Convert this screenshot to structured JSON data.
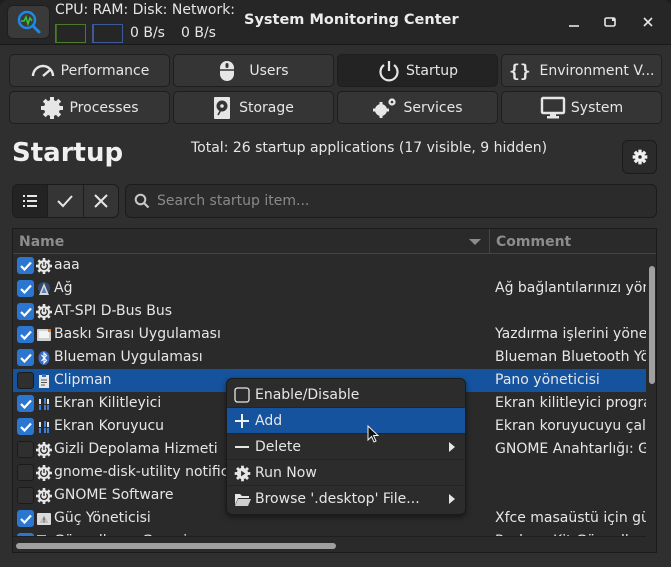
{
  "window": {
    "title": "System Monitoring Center",
    "header_labels": "CPU: RAM: Disk: Network:",
    "disk_rate": "0 B/s",
    "network_rate": "0 B/s",
    "cpu_usage_fraction": 0.05,
    "ram_usage_fraction": 0.05,
    "controls": {
      "minimize": "minimize",
      "maximize": "maximize",
      "close": "close"
    }
  },
  "tabs": [
    {
      "label": "Performance",
      "icon": "gauge-icon",
      "active": false
    },
    {
      "label": "Users",
      "icon": "mouse-icon",
      "active": false
    },
    {
      "label": "Startup",
      "icon": "power-icon",
      "active": true
    },
    {
      "label": "Environment V...",
      "icon": "braces-icon",
      "active": false
    },
    {
      "label": "Processes",
      "icon": "gear-icon",
      "active": false
    },
    {
      "label": "Storage",
      "icon": "harddisk-icon",
      "active": false
    },
    {
      "label": "Services",
      "icon": "gears-icon",
      "active": false
    },
    {
      "label": "System",
      "icon": "monitor-icon",
      "active": false
    }
  ],
  "startup": {
    "title": "Startup",
    "summary": "Total: 26 startup applications (17 visible, 9 hidden)",
    "filter_buttons": [
      "show-all",
      "show-enabled",
      "show-disabled"
    ],
    "search_placeholder": "Search startup item...",
    "columns": {
      "name": "Name",
      "comment": "Comment"
    },
    "rows": [
      {
        "enabled": true,
        "icon": "power-gear",
        "name": "aaa",
        "comment": ""
      },
      {
        "enabled": true,
        "icon": "network",
        "name": "Ağ",
        "comment": "Ağ bağlantılarınızı yöne"
      },
      {
        "enabled": true,
        "icon": "power-gear",
        "name": "AT-SPI D-Bus Bus",
        "comment": ""
      },
      {
        "enabled": true,
        "icon": "printer",
        "name": "Baskı Sırası Uygulaması",
        "comment": "Yazdırma işlerini yönetı"
      },
      {
        "enabled": true,
        "icon": "bluetooth",
        "name": "Blueman Uygulaması",
        "comment": "Blueman Bluetooth Yön"
      },
      {
        "enabled": false,
        "icon": "clipboard",
        "name": "Clipman",
        "comment": "Pano yöneticisi",
        "selected": true
      },
      {
        "enabled": true,
        "icon": "screensaver",
        "name": "Ekran Kilitleyici",
        "comment": "Ekran kilitleyici prograı"
      },
      {
        "enabled": true,
        "icon": "screensaver",
        "name": "Ekran Koruyucu",
        "comment": "Ekran koruyucuyu çalış"
      },
      {
        "enabled": false,
        "icon": "power-gear",
        "name": "Gizli Depolama Hizmeti",
        "comment": "GNOME Anahtarlığı: Giz"
      },
      {
        "enabled": false,
        "icon": "power-gear",
        "name": "gnome-disk-utility notification daemon",
        "comment": ""
      },
      {
        "enabled": false,
        "icon": "power-gear",
        "name": "GNOME Software",
        "comment": ""
      },
      {
        "enabled": true,
        "icon": "power-warn",
        "name": "Güç Yöneticisi",
        "comment": "Xfce masaüstü için güç"
      },
      {
        "enabled": true,
        "icon": "update",
        "name": "Güncelleme Gereci",
        "comment": "PackageKit Güncelleme"
      }
    ]
  },
  "context_menu": {
    "items": [
      {
        "label": "Enable/Disable",
        "icon": "checkbox-icon",
        "submenu": false,
        "hover": false
      },
      {
        "label": "Add",
        "icon": "plus-icon",
        "submenu": false,
        "hover": true
      },
      {
        "label": "Delete",
        "icon": "minus-icon",
        "submenu": true,
        "hover": false
      },
      {
        "label": "Run Now",
        "icon": "run-gear-icon",
        "submenu": false,
        "hover": false
      },
      {
        "label": "Browse '.desktop' File...",
        "icon": "folder-open-icon",
        "submenu": true,
        "hover": false
      }
    ]
  },
  "colors": {
    "accent": "#2a76d0",
    "selection": "#15539e",
    "cpu_bar": "#4b7a2a",
    "ram_bar": "#3c5a9a"
  }
}
